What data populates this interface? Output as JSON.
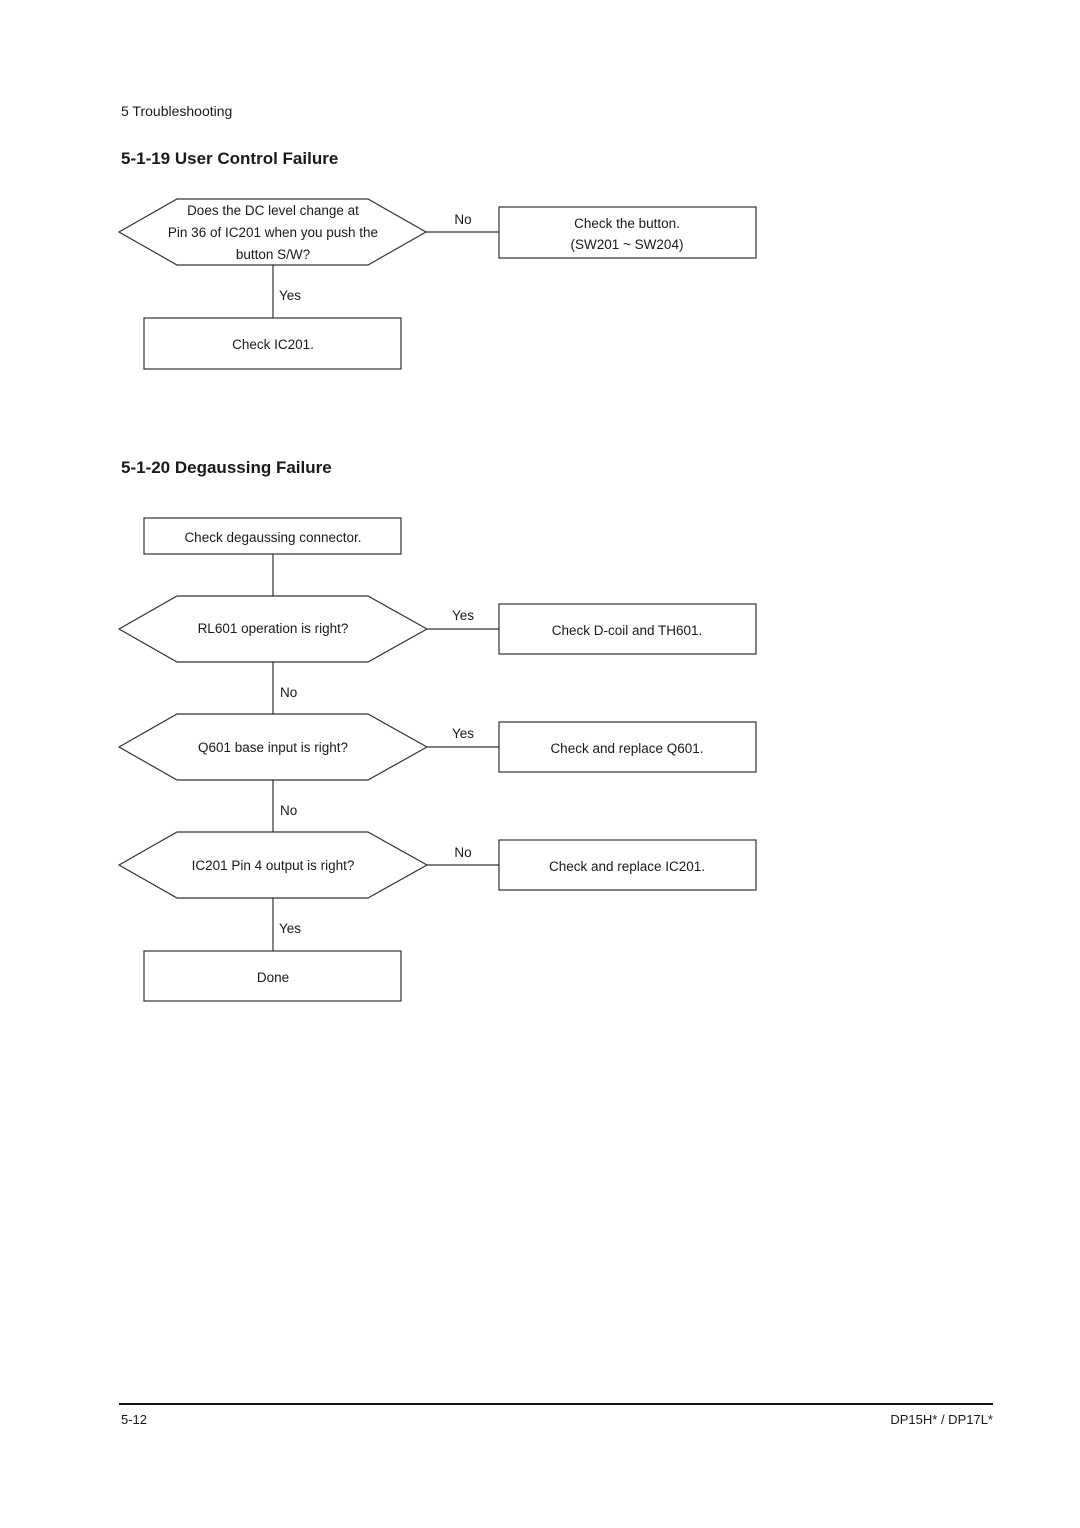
{
  "header": {
    "chapter": "5 Troubleshooting"
  },
  "sections": [
    {
      "title": "5-1-19 User Control Failure",
      "nodes": {
        "decision1": {
          "lines": [
            "Does the DC level change at",
            "Pin 36 of IC201 when you push the",
            "button S/W?"
          ]
        },
        "action_no": {
          "lines": [
            "Check the button.",
            "(SW201 ~ SW204)"
          ]
        },
        "label_no": "No",
        "label_yes": "Yes",
        "action_yes": {
          "lines": [
            "Check IC201."
          ]
        }
      }
    },
    {
      "title": "5-1-20 Degaussing Failure",
      "nodes": {
        "start": {
          "lines": [
            "Check degaussing connector."
          ]
        },
        "decision1": {
          "lines": [
            "RL601 operation is right?"
          ]
        },
        "decision1_yes_label": "Yes",
        "decision1_yes_action": {
          "lines": [
            "Check D-coil and TH601."
          ]
        },
        "decision1_no_label": "No",
        "decision2": {
          "lines": [
            "Q601 base input is right?"
          ]
        },
        "decision2_yes_label": "Yes",
        "decision2_yes_action": {
          "lines": [
            "Check and replace Q601."
          ]
        },
        "decision2_no_label": "No",
        "decision3": {
          "lines": [
            "IC201 Pin 4 output is right?"
          ]
        },
        "decision3_no_label": "No",
        "decision3_no_action": {
          "lines": [
            "Check and replace IC201."
          ]
        },
        "decision3_yes_label": "Yes",
        "end": {
          "lines": [
            "Done"
          ]
        }
      }
    }
  ],
  "footer": {
    "page_number": "5-12",
    "model": "DP15H* / DP17L*"
  }
}
